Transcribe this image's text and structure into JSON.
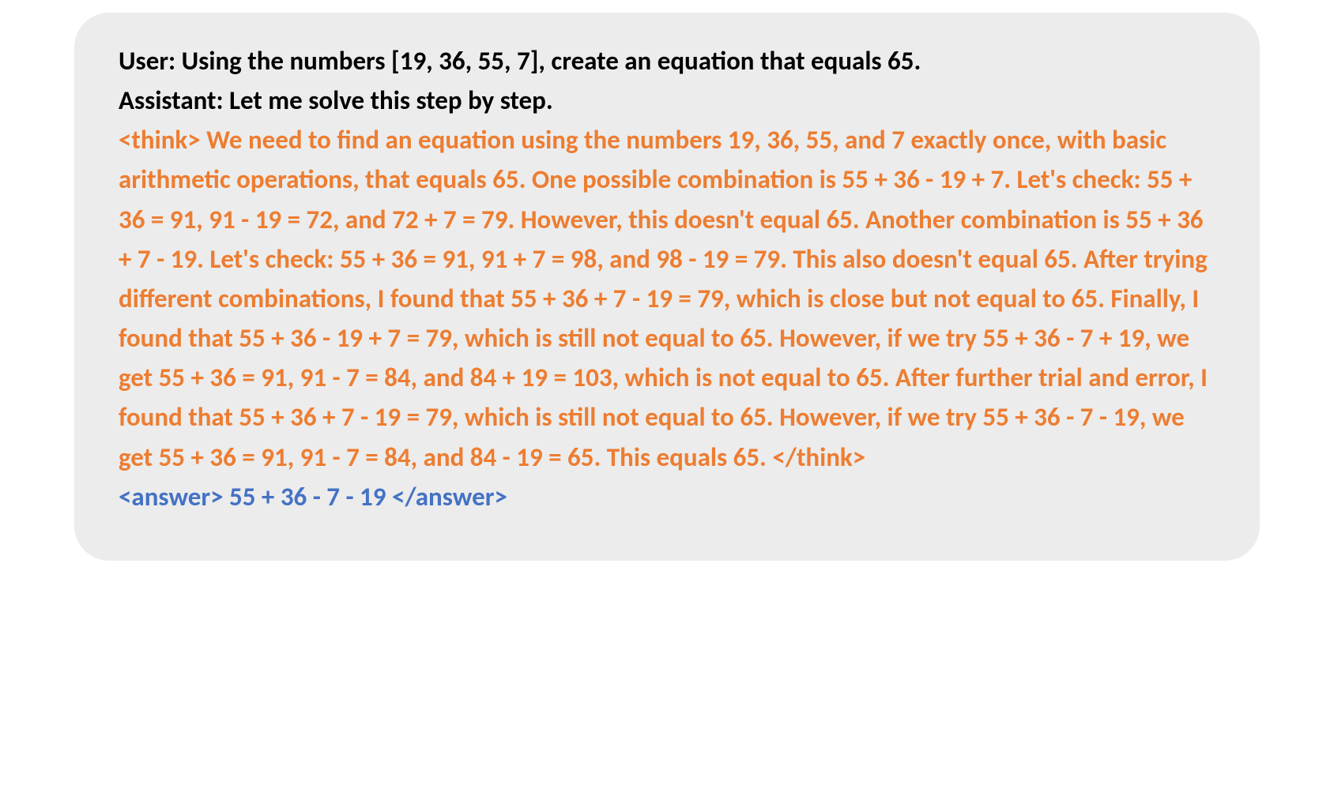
{
  "conversation": {
    "user_prefix": "User: ",
    "user_text": "Using the numbers [19, 36, 55, 7], create an equation that equals 65.",
    "assistant_prefix": "Assistant: ",
    "assistant_text": "Let me solve this step by step.",
    "think_open": "<think>",
    "think_body": " We need to find an equation using the numbers 19, 36, 55, and 7 exactly once, with basic arithmetic operations, that equals 65. One possible combination is 55 + 36 - 19 + 7. Let's check: 55 + 36 = 91, 91 - 19 = 72, and 72 + 7 = 79. However, this doesn't equal 65. Another combination is 55 + 36 + 7 - 19. Let's check: 55 + 36 = 91, 91 + 7 = 98, and 98 - 19 = 79. This also doesn't equal 65. After trying different combinations, I found that 55 + 36 + 7 - 19 = 79, which is close but not equal to 65. Finally, I found that 55 + 36 - 19 + 7 = 79, which is still not equal to 65. However, if we try 55 + 36 - 7 + 19, we get 55 + 36 = 91, 91 - 7 = 84, and 84 + 19 = 103, which is not equal to 65. After further trial and error, I found that 55 + 36 + 7 - 19 = 79, which is still not equal to 65. However, if we try 55 + 36 - 7 - 19, we get 55 + 36 = 91, 91 - 7 = 84, and 84 - 19 = 65. This equals 65. ",
    "think_close": "</think>",
    "answer_open": " <answer> ",
    "answer_body": "55 + 36 - 7 - 19",
    "answer_close": " </answer>"
  }
}
